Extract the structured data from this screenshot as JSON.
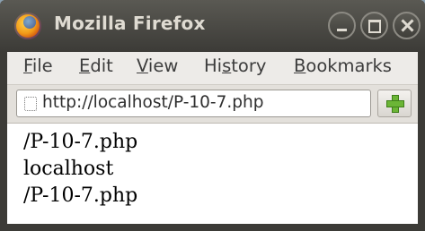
{
  "window": {
    "title": "Mozilla Firefox",
    "app_icon": "firefox-icon",
    "controls": {
      "minimize_icon": "minimize-icon",
      "maximize_icon": "maximize-icon",
      "close_icon": "close-icon"
    }
  },
  "menubar": {
    "items": [
      {
        "accel": "F",
        "rest": "ile"
      },
      {
        "accel": "E",
        "rest": "dit"
      },
      {
        "accel": "V",
        "rest": "iew"
      },
      {
        "pre": "Hi",
        "accel": "s",
        "rest": "tory"
      },
      {
        "accel": "B",
        "rest": "ookmarks"
      }
    ]
  },
  "navbar": {
    "url": "http://localhost/P-10-7.php",
    "page_icon": "blank-page-icon",
    "new_tab_icon": "plus-icon"
  },
  "content": {
    "lines": [
      "/P-10-7.php",
      "localhost",
      "/P-10-7.php"
    ]
  },
  "colors": {
    "titlebar": "#3c3b37",
    "menubar": "#edebe8",
    "plus": "#6bb536"
  }
}
